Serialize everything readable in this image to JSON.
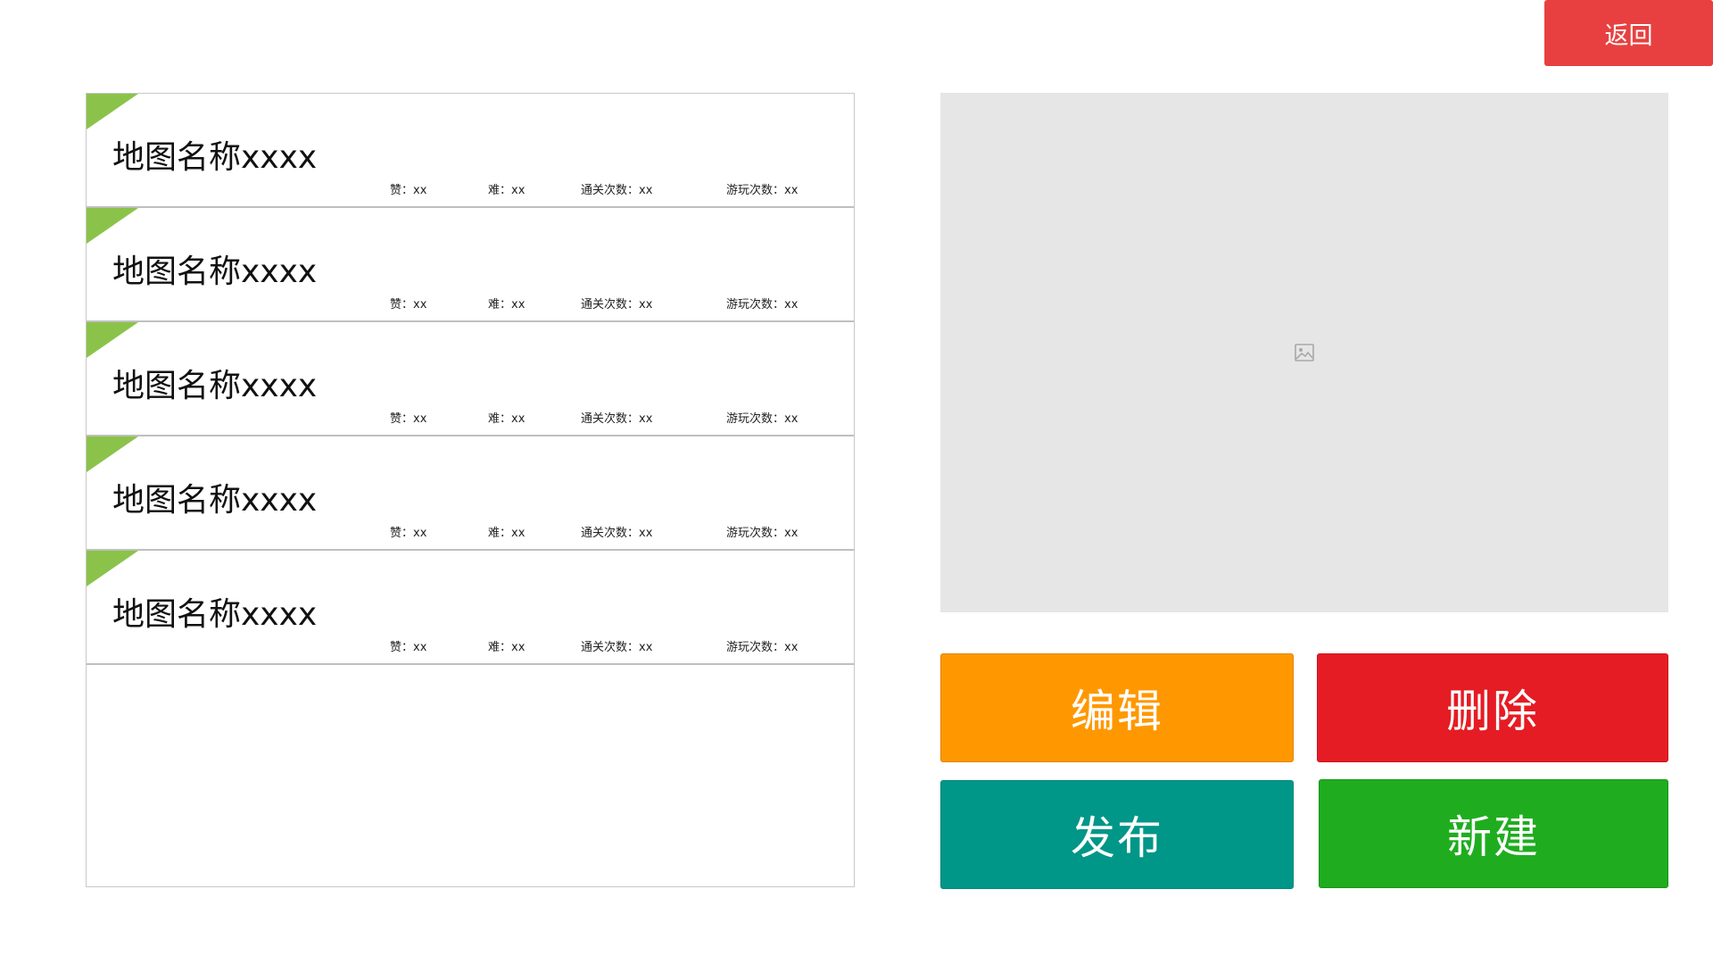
{
  "header": {
    "back_label": "返回"
  },
  "map_list": {
    "items": [
      {
        "name": "地图名称xxxx",
        "like": "赞：xx",
        "difficulty": "难：xx",
        "clears": "通关次数：xx",
        "plays": "游玩次数：xx"
      },
      {
        "name": "地图名称xxxx",
        "like": "赞：xx",
        "difficulty": "难：xx",
        "clears": "通关次数：xx",
        "plays": "游玩次数：xx"
      },
      {
        "name": "地图名称xxxx",
        "like": "赞：xx",
        "difficulty": "难：xx",
        "clears": "通关次数：xx",
        "plays": "游玩次数：xx"
      },
      {
        "name": "地图名称xxxx",
        "like": "赞：xx",
        "difficulty": "难：xx",
        "clears": "通关次数：xx",
        "plays": "游玩次数：xx"
      },
      {
        "name": "地图名称xxxx",
        "like": "赞：xx",
        "difficulty": "难：xx",
        "clears": "通关次数：xx",
        "plays": "游玩次数：xx"
      }
    ],
    "tag_color": "#8bc34a"
  },
  "preview": {
    "icon": "image-icon"
  },
  "actions": {
    "edit_label": "编辑",
    "delete_label": "删除",
    "publish_label": "发布",
    "new_label": "新建",
    "colors": {
      "edit": "#ff9800",
      "delete": "#e51c23",
      "publish": "#009688",
      "new": "#1fad1f",
      "back": "#e84040"
    }
  }
}
